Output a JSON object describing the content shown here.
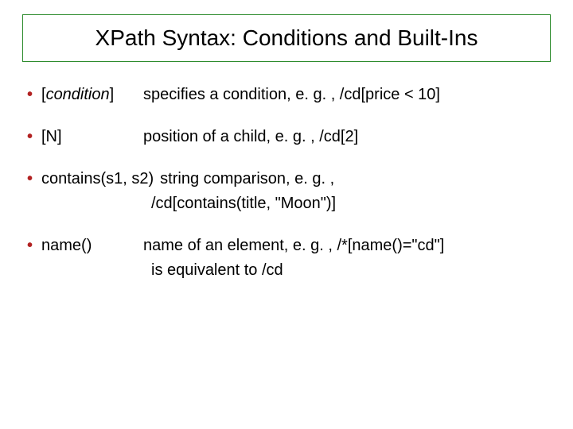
{
  "title": "XPath Syntax: Conditions and Built-Ins",
  "items": [
    {
      "term_prefix": "[",
      "term_italic": "condition",
      "term_suffix": "]",
      "desc": "specifies a condition, e. g. , /cd[price < 10]"
    },
    {
      "term": "[N]",
      "desc": "position of a child, e. g. , /cd[2]"
    },
    {
      "term": "contains(s1, s2)",
      "desc": "string comparison, e. g. ,",
      "sub": "/cd[contains(title, \"Moon\")]"
    },
    {
      "term": "name()",
      "desc": "name of an element, e. g. , /*[name()=\"cd\"]",
      "sub": "is equivalent to /cd"
    }
  ]
}
